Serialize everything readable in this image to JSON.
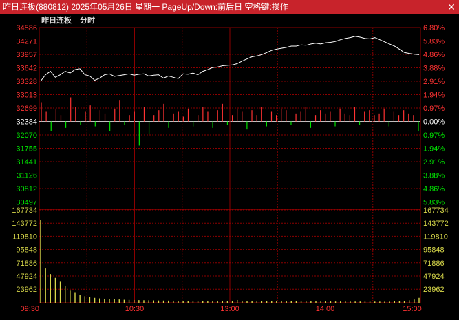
{
  "window": {
    "title": "昨日连板(880812)  2025年05月26日  星期一  PageUp/Down:前后日  空格键:操作",
    "close_glyph": "✕"
  },
  "tabs": [
    "昨日连板",
    "分时"
  ],
  "colors": {
    "up": "#ff3232",
    "down": "#00e600",
    "grid": "#8b0000",
    "price_line": "#ffffff",
    "volume": "#d8d84a",
    "flat": "#ffffff",
    "time_axis": "#ff3232",
    "title_bg": "#c8232b"
  },
  "price_axis": {
    "left_labels": [
      "34586",
      "34271",
      "33957",
      "33642",
      "33328",
      "33013",
      "32699",
      "32384",
      "32070",
      "31755",
      "31441",
      "31126",
      "30812",
      "30497"
    ],
    "right_labels": [
      "6.80%",
      "5.83%",
      "4.86%",
      "3.88%",
      "2.91%",
      "1.94%",
      "0.97%",
      "0.00%",
      "0.97%",
      "1.94%",
      "2.91%",
      "3.88%",
      "4.86%",
      "5.83%"
    ],
    "reference_index": 7
  },
  "volume_axis": {
    "labels": [
      "167734",
      "143772",
      "119810",
      "95848",
      "71886",
      "47924",
      "23962"
    ]
  },
  "time_axis": {
    "labels": [
      "09:30",
      "10:30",
      "13:00",
      "14:00",
      "15:00"
    ]
  },
  "chart_data": {
    "type": "line",
    "reference_price": 32384,
    "x_range": [
      "09:30",
      "15:00"
    ],
    "price_range": [
      30497,
      34586
    ],
    "price_series": [
      33330,
      33480,
      33560,
      33420,
      33480,
      33560,
      33520,
      33600,
      33620,
      33480,
      33450,
      33350,
      33400,
      33480,
      33500,
      33440,
      33460,
      33480,
      33500,
      33470,
      33490,
      33500,
      33450,
      33470,
      33480,
      33400,
      33450,
      33420,
      33390,
      33500,
      33490,
      33520,
      33480,
      33560,
      33600,
      33650,
      33660,
      33690,
      33700,
      33710,
      33740,
      33800,
      33850,
      33900,
      33920,
      33950,
      34000,
      34050,
      34080,
      34100,
      34120,
      34150,
      34150,
      34180,
      34170,
      34200,
      34220,
      34200,
      34230,
      34240,
      34260,
      34300,
      34330,
      34350,
      34380,
      34360,
      34330,
      34320,
      34350,
      34300,
      34250,
      34200,
      34150,
      34080,
      34000,
      33980,
      33960,
      33950
    ],
    "bar_series": [
      120,
      60,
      -60,
      80,
      40,
      -40,
      150,
      90,
      -20,
      60,
      100,
      -30,
      70,
      50,
      -60,
      80,
      130,
      -20,
      40,
      60,
      -150,
      90,
      -80,
      40,
      70,
      110,
      -40,
      50,
      60,
      30,
      80,
      -30,
      40,
      90,
      60,
      -40,
      70,
      110,
      -20,
      40,
      80,
      60,
      -50,
      70,
      40,
      90,
      -30,
      60,
      40,
      80,
      70,
      -20,
      50,
      60,
      90,
      -40,
      40,
      70,
      50,
      60,
      -30,
      80,
      50,
      40,
      90,
      -20,
      60,
      70,
      40,
      50,
      80,
      -30,
      60,
      40,
      70,
      50,
      40,
      -60
    ],
    "volume_series": [
      150000,
      62000,
      52000,
      45000,
      38000,
      30000,
      22000,
      18000,
      14000,
      12000,
      11000,
      9000,
      8000,
      7500,
      7000,
      6500,
      6000,
      5500,
      5200,
      5000,
      4800,
      4600,
      4500,
      4300,
      4100,
      4000,
      3900,
      3800,
      3700,
      3600,
      3500,
      3400,
      3300,
      3300,
      3200,
      3200,
      3100,
      3100,
      3000,
      3000,
      5000,
      3200,
      3000,
      3000,
      2900,
      2900,
      2800,
      2800,
      2700,
      2700,
      2700,
      2600,
      2600,
      2600,
      2500,
      2500,
      2500,
      2400,
      2400,
      2400,
      2300,
      2300,
      2300,
      2200,
      2200,
      2200,
      2200,
      2100,
      2100,
      2100,
      2000,
      2000,
      2500,
      3000,
      3500,
      4500,
      6000,
      9000
    ],
    "volume_range": [
      0,
      167734
    ]
  }
}
